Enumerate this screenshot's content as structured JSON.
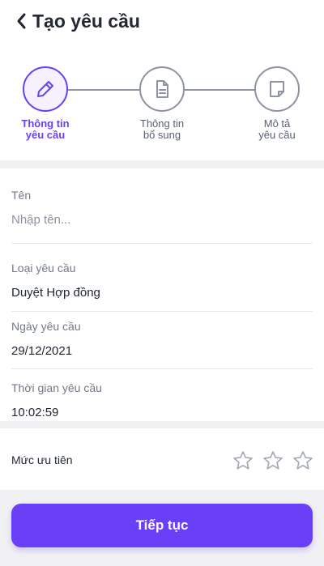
{
  "header": {
    "title": "Tạo yêu cầu"
  },
  "steps": [
    {
      "label_line1": "Thông tin",
      "label_line2": "yêu cầu",
      "icon": "pencil-icon",
      "active": true
    },
    {
      "label_line1": "Thông tin",
      "label_line2": "bổ sung",
      "icon": "document-icon",
      "active": false
    },
    {
      "label_line1": "Mô tả",
      "label_line2": "yêu cầu",
      "icon": "note-icon",
      "active": false
    }
  ],
  "form": {
    "name": {
      "label": "Tên",
      "placeholder": "Nhập tên..."
    },
    "request_type": {
      "label": "Loại yêu cầu",
      "value": "Duyệt Hợp đồng"
    },
    "request_date": {
      "label": "Ngày yêu cầu",
      "value": "29/12/2021"
    },
    "request_time": {
      "label": "Thời gian yêu cầu",
      "value": "10:02:59"
    }
  },
  "priority": {
    "label": "Mức ưu tiên",
    "rating": 0,
    "max": 3
  },
  "actions": {
    "continue_label": "Tiếp tục"
  },
  "colors": {
    "accent": "#6a40f6",
    "inactive": "#8d93a3"
  }
}
